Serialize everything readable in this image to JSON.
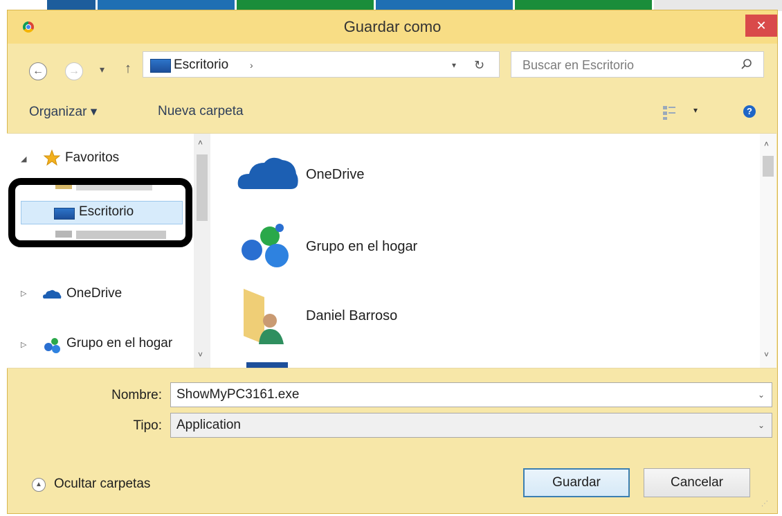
{
  "background_strip": {
    "segments": [
      {
        "color": "#1d5d9c"
      },
      {
        "color": "#1f6fb3"
      },
      {
        "color": "#1a8d3a"
      },
      {
        "color": "#1f6fb3"
      },
      {
        "color": "#1a8d3a"
      },
      {
        "color": "#e8e8e8"
      }
    ]
  },
  "window": {
    "title": "Guardar como",
    "close_glyph": "✕",
    "app_icon": "chrome-icon"
  },
  "address": {
    "back_glyph": "←",
    "forward_glyph": "→",
    "recent_glyph": "▾",
    "up_glyph": "↑",
    "location_icon": "desktop-icon",
    "location": "Escritorio",
    "separator": "›",
    "dropdown_glyph": "▾",
    "refresh_glyph": "↻"
  },
  "search": {
    "placeholder": "Buscar en Escritorio",
    "icon": "search-icon"
  },
  "toolbar": {
    "organize": "Organizar ▾",
    "new_folder": "Nueva carpeta",
    "view_icon": "change-view-icon",
    "view_caret": "▾",
    "help_glyph": "?"
  },
  "nav_tree": {
    "items": [
      {
        "label": "Favoritos",
        "toggle": "◢",
        "icon": "star-icon"
      },
      {
        "label": "Escritorio",
        "icon": "desktop-icon",
        "selected": true
      },
      {
        "label": "OneDrive",
        "toggle": "▷",
        "icon": "onedrive-icon"
      },
      {
        "label": "Grupo en el hogar",
        "toggle": "▷",
        "icon": "homegroup-icon"
      }
    ],
    "scroll_up": "˄",
    "scroll_down": "˅"
  },
  "content": {
    "items": [
      {
        "label": "OneDrive",
        "icon": "onedrive-cloud-icon"
      },
      {
        "label": "Grupo en el hogar",
        "icon": "homegroup-icon"
      },
      {
        "label": "Daniel Barroso",
        "icon": "user-folder-icon"
      }
    ],
    "scroll_up": "˄",
    "scroll_down": "˅"
  },
  "form": {
    "name_label": "Nombre:",
    "name_value": "ShowMyPC3161.exe",
    "type_label": "Tipo:",
    "type_value": "Application",
    "caret": "⌄"
  },
  "footer": {
    "hide_folders_glyph": "▲",
    "hide_folders": "Ocultar carpetas",
    "save": "Guardar",
    "cancel": "Cancelar",
    "grip": "⋰"
  },
  "colors": {
    "frame": "#f7e7a8",
    "titlebar": "#f8dd85",
    "close": "#d94a4a",
    "selection": "#d7ebfb",
    "accent": "#1e66c7"
  }
}
